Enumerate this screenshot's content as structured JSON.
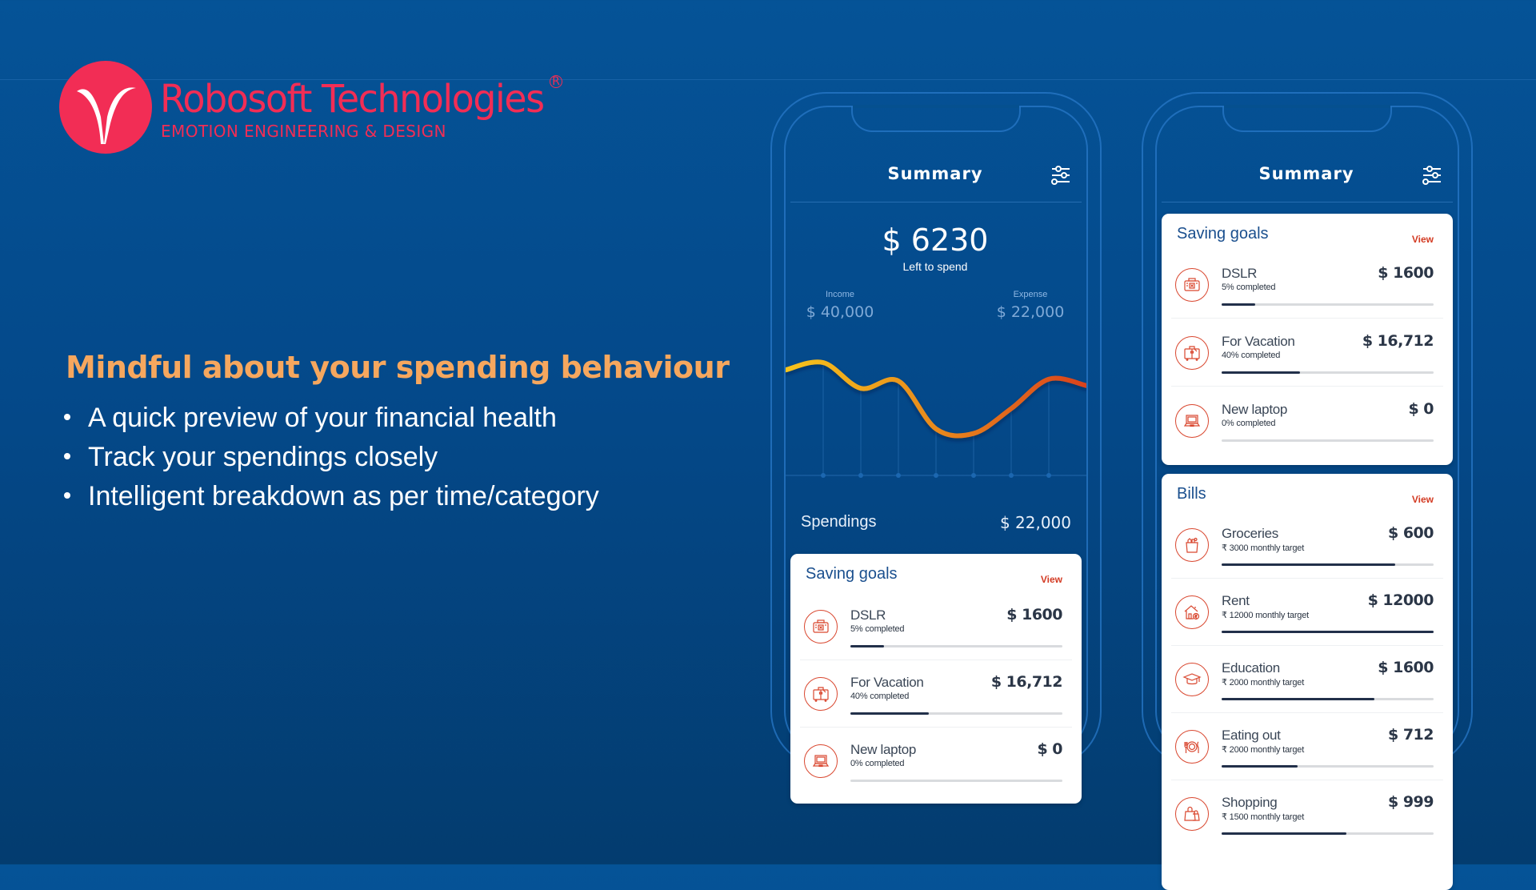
{
  "brand": {
    "name": "Robosoft Technologies",
    "registered_mark": "R",
    "tagline": "EMOTION ENGINEERING & DESIGN",
    "color": "#f22d55"
  },
  "hero": {
    "headline": "Mindful about your spending behaviour",
    "headline_color": "#f6a75e",
    "bullets": [
      "A quick preview of your financial health",
      "Track your spendings closely",
      "Intelligent breakdown as per time/category"
    ]
  },
  "phone1": {
    "title": "Summary",
    "filter_icon": "sliders-icon",
    "left_to_spend_amount": "$ 6230",
    "left_to_spend_label": "Left to spend",
    "income_label": "Income",
    "income_value": "$ 40,000",
    "expense_label": "Expense",
    "expense_value": "$ 22,000",
    "spendings_label": "Spendings",
    "spendings_value": "$ 22,000",
    "saving_goals": {
      "title": "Saving goals",
      "view_label": "View",
      "items": [
        {
          "icon": "camera-icon",
          "name": "DSLR",
          "sub": "5% completed",
          "amount": "$ 1600",
          "progress": 0.16
        },
        {
          "icon": "suitcase-icon",
          "name": "For Vacation",
          "sub": "40% completed",
          "amount": "$ 16,712",
          "progress": 0.37
        },
        {
          "icon": "laptop-icon",
          "name": "New laptop",
          "sub": "0% completed",
          "amount": "$ 0",
          "progress": 0
        }
      ]
    }
  },
  "phone2": {
    "title": "Summary",
    "filter_icon": "sliders-icon",
    "saving_goals": {
      "title": "Saving goals",
      "view_label": "View",
      "items": [
        {
          "icon": "camera-icon",
          "name": "DSLR",
          "sub": "5% completed",
          "amount": "$ 1600",
          "progress": 0.16
        },
        {
          "icon": "suitcase-icon",
          "name": "For Vacation",
          "sub": "40% completed",
          "amount": "$ 16,712",
          "progress": 0.37
        },
        {
          "icon": "laptop-icon",
          "name": "New laptop",
          "sub": "0% completed",
          "amount": "$ 0",
          "progress": 0
        }
      ]
    },
    "bills": {
      "title": "Bills",
      "view_label": "View",
      "items": [
        {
          "icon": "grocery-bag-icon",
          "name": "Groceries",
          "sub": "₹ 3000 monthly target",
          "amount": "$ 600",
          "progress": 0.82
        },
        {
          "icon": "house-icon",
          "name": "Rent",
          "sub": "₹ 12000 monthly target",
          "amount": "$ 12000",
          "progress": 1.0
        },
        {
          "icon": "graduation-cap-icon",
          "name": "Education",
          "sub": "₹ 2000 monthly target",
          "amount": "$ 1600",
          "progress": 0.72
        },
        {
          "icon": "plate-cutlery-icon",
          "name": "Eating out",
          "sub": "₹ 2000 monthly target",
          "amount": "$ 712",
          "progress": 0.36
        },
        {
          "icon": "shopping-bag-icon",
          "name": "Shopping",
          "sub": "₹ 1500 monthly target",
          "amount": "$ 999",
          "progress": 0.59
        }
      ]
    }
  },
  "chart_data": {
    "type": "line",
    "title": "",
    "xlabel": "",
    "ylabel": "",
    "x": [
      0,
      1,
      2,
      3,
      4,
      5,
      6,
      7,
      8
    ],
    "x_ticks": [
      1,
      2,
      3,
      4,
      5,
      6,
      7
    ],
    "tick_labels": [],
    "series": [
      {
        "name": "Spendings",
        "values": [
          0.72,
          0.8,
          0.52,
          0.6,
          0.08,
          0.03,
          0.3,
          0.62,
          0.55
        ]
      }
    ],
    "ylim": [
      0,
      1
    ],
    "grid": "vertical",
    "gradient": [
      "#f7c41e",
      "#e8891d",
      "#d9421f"
    ]
  }
}
